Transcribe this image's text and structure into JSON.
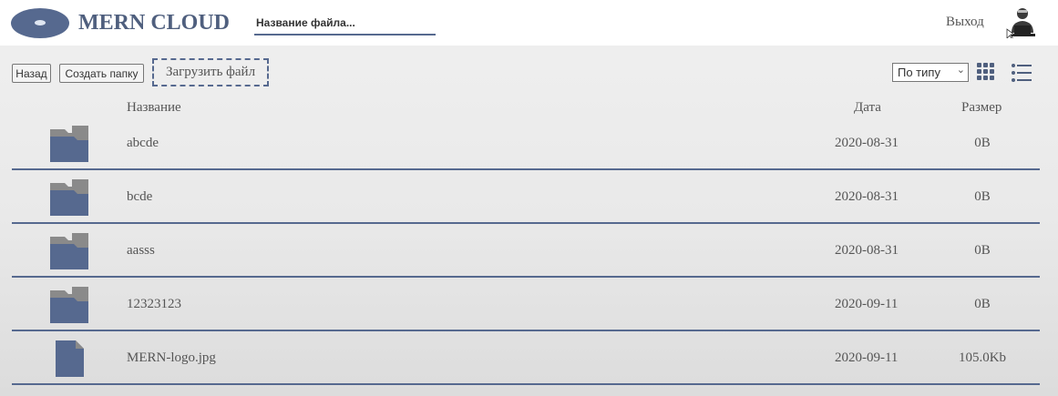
{
  "navbar": {
    "title": "MERN CLOUD",
    "search_placeholder": "Название файла...",
    "logout_label": "Выход"
  },
  "toolbar": {
    "back_label": "Назад",
    "create_folder_label": "Создать папку",
    "upload_label": "Загрузить файл",
    "sort_selected": "По типу"
  },
  "table": {
    "headers": {
      "name": "Название",
      "date": "Дата",
      "size": "Размер"
    },
    "rows": [
      {
        "type": "folder",
        "name": "abcde",
        "date": "2020-08-31",
        "size": "0B"
      },
      {
        "type": "folder",
        "name": "bcde",
        "date": "2020-08-31",
        "size": "0B"
      },
      {
        "type": "folder",
        "name": "aasss",
        "date": "2020-08-31",
        "size": "0B"
      },
      {
        "type": "folder",
        "name": "12323123",
        "date": "2020-09-11",
        "size": "0B"
      },
      {
        "type": "file",
        "name": "MERN-logo.jpg",
        "date": "2020-09-11",
        "size": "105.0Kb"
      }
    ]
  },
  "icons": {
    "logo": "disk-logo-icon",
    "avatar": "user-avatar-icon",
    "plate_view": "grid-view-icon",
    "list_view": "list-view-icon",
    "folder": "folder-icon",
    "file": "file-icon"
  },
  "colors": {
    "accent": "#56698f",
    "folder_back": "#8a8a8a",
    "folder_front": "#56698f",
    "text": "#555555"
  }
}
